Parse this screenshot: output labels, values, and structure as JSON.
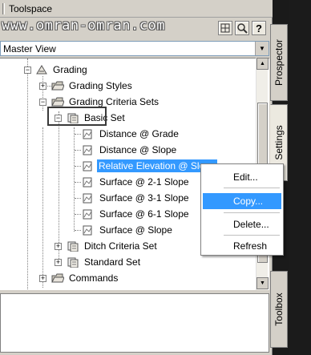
{
  "toolspace": {
    "title": "Toolspace",
    "watermark": "www.omran-omran.com",
    "view_selector": "Master View",
    "icons": [
      "grid-icon",
      "search-icon",
      "help-icon"
    ]
  },
  "tree": [
    {
      "id": "grading",
      "label": "Grading"
    },
    {
      "id": "grading-styles",
      "label": "Grading Styles"
    },
    {
      "id": "grading-criteria-sets",
      "label": "Grading Criteria Sets"
    },
    {
      "id": "basic-set",
      "label": "Basic Set"
    },
    {
      "id": "distance-grade",
      "label": "Distance @ Grade"
    },
    {
      "id": "distance-slope",
      "label": "Distance @ Slope"
    },
    {
      "id": "relative-elevation-slope",
      "label": "Relative Elevation @ Slope"
    },
    {
      "id": "surface-2-1",
      "label": "Surface @ 2-1 Slope"
    },
    {
      "id": "surface-3-1",
      "label": "Surface @ 3-1 Slope"
    },
    {
      "id": "surface-6-1",
      "label": "Surface @ 6-1 Slope"
    },
    {
      "id": "surface-slope",
      "label": "Surface @ Slope"
    },
    {
      "id": "ditch-criteria-set",
      "label": "Ditch Criteria Set"
    },
    {
      "id": "standard-set",
      "label": "Standard Set"
    },
    {
      "id": "commands",
      "label": "Commands"
    }
  ],
  "tabs": {
    "prospector": "Prospector",
    "settings": "Settings",
    "toolbox": "Toolbox"
  },
  "context_menu": {
    "edit": "Edit...",
    "copy": "Copy...",
    "delete": "Delete...",
    "refresh": "Refresh"
  },
  "colors": {
    "selection": "#3399ff",
    "panel": "#d4d0c8"
  }
}
